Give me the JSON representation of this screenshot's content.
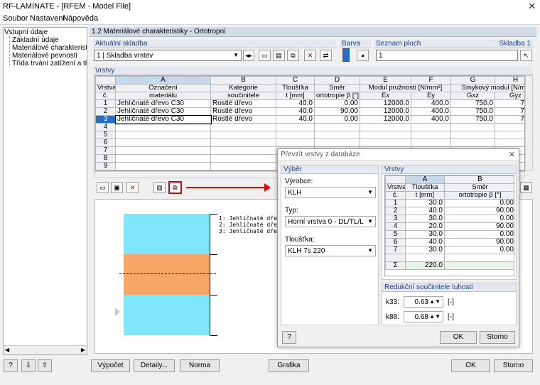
{
  "window": {
    "title": "RF-LAMINATE - [RFEM - Model File]",
    "close_glyph": "✕"
  },
  "menu": [
    "Soubor",
    "Nastavení",
    "Nápověda"
  ],
  "tree": {
    "root": "Vstupní údaje",
    "items": [
      "Základní údaje",
      "Materiálové charakteristiky",
      "Materiálové pevnosti",
      "Třída trvání zatížení a třída pro"
    ]
  },
  "panel": {
    "title": "1.2 Materiálové charakteristiky - Ortotropní"
  },
  "current_layup": {
    "label": "Aktuální skladba",
    "value": "1 | Skladba vrstev"
  },
  "color": {
    "label": "Barva",
    "swatch": "#1e6fd0"
  },
  "surfaces": {
    "label": "Seznam ploch",
    "value": "1",
    "right_label": "Skladba 1"
  },
  "layers": {
    "label": "Vrstvy",
    "col_letters": [
      "A",
      "B",
      "C",
      "D",
      "E",
      "F",
      "G",
      "H"
    ],
    "hdr_row": "Vrstva",
    "hdr_row2": "č.",
    "hdr_A": "Označení",
    "hdr_A2": "materiálu",
    "hdr_B": "Kategorie",
    "hdr_B2": "součinitele",
    "hdr_C": "Tloušťka",
    "hdr_C2": "t [mm]",
    "hdr_D": "Směr",
    "hdr_D2": "ortotropie β [°]",
    "hdr_EF": "Modul pružnosti [N/mm²]",
    "hdr_E2": "Ex",
    "hdr_F2": "Ey",
    "hdr_GH": "Smykový modul [N/m",
    "hdr_G2": "Gxz",
    "hdr_H2": "Gyz",
    "rows": [
      {
        "n": "1",
        "a": "Jehličnaté dřevo C30",
        "b": "Rostlé dřevo",
        "c": "40.0",
        "d": "0.00",
        "e": "12000.0",
        "f": "400.0",
        "g": "750.0",
        "h": "75.0"
      },
      {
        "n": "2",
        "a": "Jehličnaté dřevo C30",
        "b": "Rostlé dřevo",
        "c": "40.0",
        "d": "90.00",
        "e": "12000.0",
        "f": "400.0",
        "g": "750.0",
        "h": "75.0"
      },
      {
        "n": "3",
        "a": "Jehličnaté dřevo C30",
        "b": "Rostlé dřevo",
        "c": "40.0",
        "d": "0.00",
        "e": "12000.0",
        "f": "400.0",
        "g": "750.0",
        "h": "75.0"
      },
      {
        "n": "4",
        "a": "",
        "b": "",
        "c": "",
        "d": "",
        "e": "",
        "f": "",
        "g": "",
        "h": ""
      },
      {
        "n": "5",
        "a": "",
        "b": "",
        "c": "",
        "d": "",
        "e": "",
        "f": "",
        "g": "",
        "h": ""
      },
      {
        "n": "6",
        "a": "",
        "b": "",
        "c": "",
        "d": "",
        "e": "",
        "f": "",
        "g": "",
        "h": ""
      },
      {
        "n": "7",
        "a": "",
        "b": "",
        "c": "",
        "d": "",
        "e": "",
        "f": "",
        "g": "",
        "h": ""
      },
      {
        "n": "8",
        "a": "",
        "b": "",
        "c": "",
        "d": "",
        "e": "",
        "f": "",
        "g": "",
        "h": ""
      },
      {
        "n": "9",
        "a": "",
        "b": "",
        "c": "",
        "d": "",
        "e": "",
        "f": "",
        "g": "",
        "h": ""
      }
    ]
  },
  "preview": {
    "legend": [
      "1: Jehličnaté dřevo C30",
      "2: Jehličnaté dřevo C30",
      "3: Jehličnaté dřevo C30"
    ]
  },
  "bottom": {
    "calc": "Výpočet",
    "details": "Detaily...",
    "norm": "Norma",
    "graphics": "Grafika",
    "ok": "OK",
    "cancel": "Storno"
  },
  "dialog": {
    "title": "Převzít vrstvy z databáze",
    "close_glyph": "✕",
    "selection": "Výběr",
    "manufacturer_label": "Výrobce:",
    "manufacturer": "KLH",
    "type_label": "Typ:",
    "type": "Horní vrstva 0 - DL/TL/L",
    "thickness_label": "Tloušťka:",
    "thickness": "KLH 7s 220",
    "layers_label": "Vrstvy",
    "colA": "A",
    "colB": "B",
    "hdr_row": "Vrstva",
    "hdr_row2": "č.",
    "hdr_A": "Tloušťka",
    "hdr_A2": "t [mm]",
    "hdr_B": "Směr",
    "hdr_B2": "ortotropie β [°]",
    "rows": [
      {
        "n": "1",
        "t": "30.0",
        "b": "0.00"
      },
      {
        "n": "2",
        "t": "40.0",
        "b": "90.00"
      },
      {
        "n": "3",
        "t": "30.0",
        "b": "0.00"
      },
      {
        "n": "4",
        "t": "20.0",
        "b": "90.00"
      },
      {
        "n": "5",
        "t": "30.0",
        "b": "0.00"
      },
      {
        "n": "6",
        "t": "40.0",
        "b": "90.00"
      },
      {
        "n": "7",
        "t": "30.0",
        "b": "0.00"
      }
    ],
    "sum_label": "Σ",
    "sum": "220.0",
    "reduction_label": "Redukční součinitele tuhosti",
    "k33_label": "k33:",
    "k33": "0.63",
    "k33_unit": "[-]",
    "k88_label": "k88:",
    "k88": "0.68",
    "k88_unit": "[-]",
    "ok": "OK",
    "cancel": "Storno"
  }
}
